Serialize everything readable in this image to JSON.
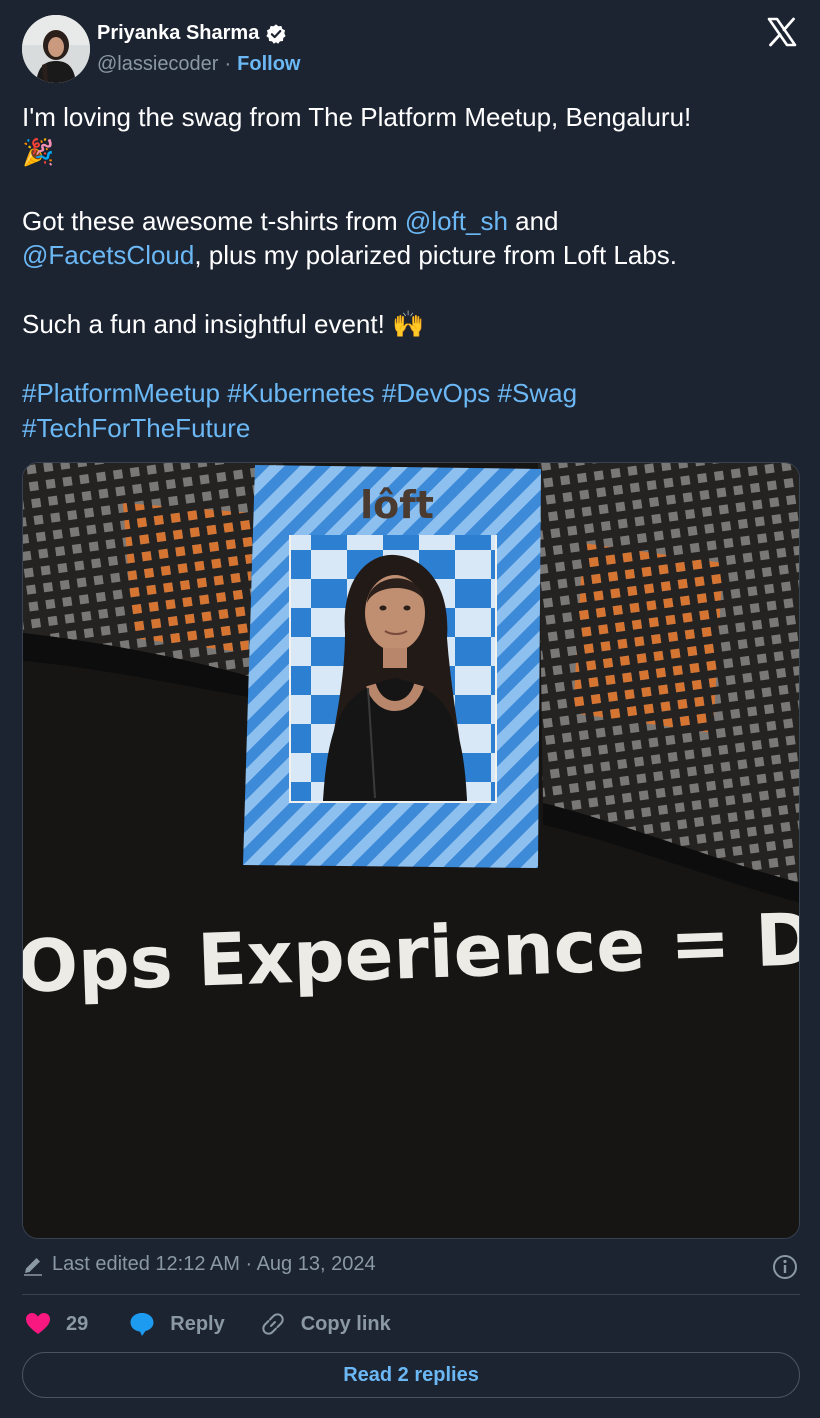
{
  "author": {
    "name": "Priyanka Sharma",
    "handle": "@lassiecoder",
    "separator": "·",
    "follow_label": "Follow"
  },
  "tweet": {
    "line1": "I'm loving the swag from The Platform Meetup, Bengaluru!",
    "line1_emoji": "🎉",
    "line2_pre": "Got these awesome t-shirts from ",
    "mention1": "@loft_sh",
    "line2_mid": " and",
    "mention2": "@FacetsCloud",
    "line3_post": ", plus my polarized picture from Loft Labs.",
    "line4": "Such a fun and insightful event! ",
    "line4_emoji": "🙌",
    "hashtags_row1": [
      "#PlatformMeetup",
      "#Kubernetes",
      "#DevOps",
      "#Swag"
    ],
    "hashtags_row2": [
      "#TechForTheFuture"
    ]
  },
  "photo": {
    "frame_brand": "lôft",
    "pattern_text": "lôft",
    "shirt_text": "Ops Experience = Dev E"
  },
  "meta": {
    "edited": "Last edited 12:12 AM · Aug 13, 2024"
  },
  "actions": {
    "like_count": "29",
    "reply_label": "Reply",
    "copy_label": "Copy link",
    "read_replies_label": "Read 2 replies"
  },
  "colors": {
    "background": "#1c2331",
    "link": "#6bb8f5",
    "muted": "#8b98a5",
    "like": "#f91880",
    "frame_blue": "#3d8ad8"
  }
}
